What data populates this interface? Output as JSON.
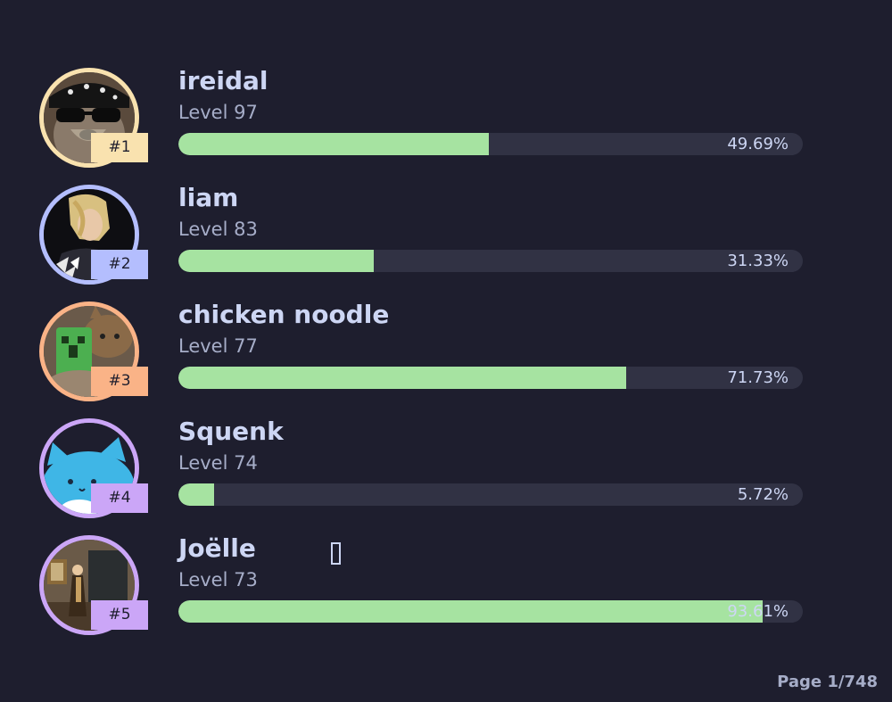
{
  "leaderboard": [
    {
      "rank_label": "#1",
      "name": "ireidal",
      "level_label": "Level 97",
      "progress_pct": 49.69,
      "progress_label": "49.69%",
      "accent": "#f9e2af",
      "avatar": "raccoon-avatar"
    },
    {
      "rank_label": "#2",
      "name": "liam",
      "level_label": "Level 83",
      "progress_pct": 31.33,
      "progress_label": "31.33%",
      "accent": "#b4befe",
      "avatar": "anime-character-avatar"
    },
    {
      "rank_label": "#3",
      "name": "chicken noodle",
      "level_label": "Level 77",
      "progress_pct": 71.73,
      "progress_label": "71.73%",
      "accent": "#fab387",
      "avatar": "cat-creeper-avatar"
    },
    {
      "rank_label": "#4",
      "name": "Squenk",
      "level_label": "Level 74",
      "progress_pct": 5.72,
      "progress_label": "5.72%",
      "accent": "#cba6f7",
      "avatar": "blue-cat-avatar"
    },
    {
      "rank_label": "#5",
      "name": "Joëlle",
      "level_label": "Level 73",
      "progress_pct": 93.61,
      "progress_label": "93.61%",
      "accent": "#cba6f7",
      "avatar": "room-photo-avatar"
    }
  ],
  "colors": {
    "background": "#1e1e2e",
    "bar_fill": "#a6e3a1",
    "bar_track": "#313244",
    "name_text": "#cdd6f4",
    "level_text": "#a6adc8"
  },
  "footer": {
    "page_label": "Page 1/748"
  }
}
